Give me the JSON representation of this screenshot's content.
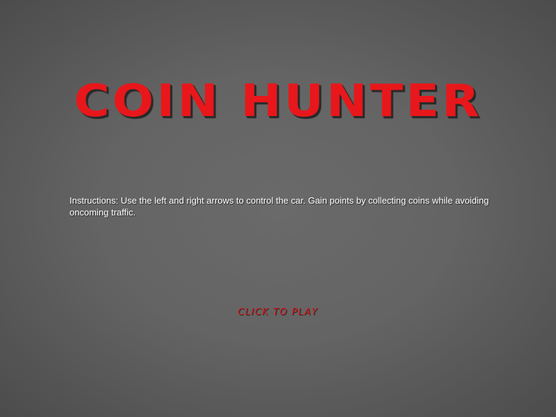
{
  "title": "COIN HUNTER",
  "instructions": "Instructions: Use the left and right arrows to control the car.  Gain points by collecting coins while avoiding oncoming traffic.",
  "play_button_label": "CLICK TO PLAY",
  "colors": {
    "title": "#e8171b",
    "play_button": "#d8161a",
    "instructions": "#ffffff",
    "background": "#646464"
  }
}
